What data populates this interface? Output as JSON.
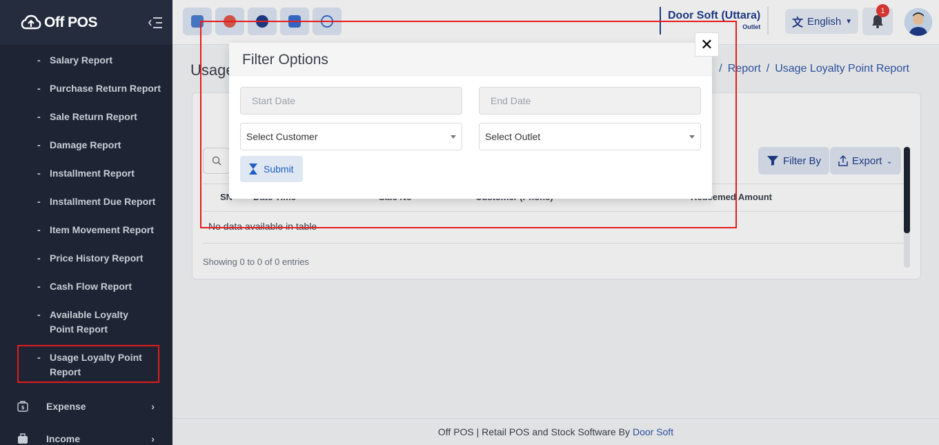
{
  "app": {
    "logo_text": "Off POS"
  },
  "sidebar": {
    "sub_items": [
      {
        "label": "Salary Report"
      },
      {
        "label": "Purchase Return Report"
      },
      {
        "label": "Sale Return Report"
      },
      {
        "label": "Damage Report"
      },
      {
        "label": "Installment Report"
      },
      {
        "label": "Installment Due Report"
      },
      {
        "label": "Item Movement Report"
      },
      {
        "label": "Price History Report"
      },
      {
        "label": "Cash Flow Report"
      },
      {
        "label": "Available Loyalty Point Report"
      },
      {
        "label": "Usage Loyalty Point Report"
      }
    ],
    "dash": "-",
    "main_items": [
      {
        "label": "Expense",
        "icon": "expense-icon"
      },
      {
        "label": "Income",
        "icon": "income-icon"
      }
    ]
  },
  "header": {
    "store_name": "Door Soft (Uttara)",
    "store_sub": "Outlet",
    "language": "English",
    "notification_count": "1"
  },
  "page": {
    "title": "Usage Loyalty Point Report",
    "breadcrumb": [
      "Report",
      "Usage Loyalty Point Report"
    ],
    "breadcrumb_sep": "/",
    "filter_label": "Filter By",
    "export_label": "Export",
    "table": {
      "columns": [
        "SN",
        "Date Time",
        "Sale No",
        "Customer (Phone)",
        "Redeemed Amount"
      ],
      "empty_text": "No data available in table",
      "info": "Showing 0 to 0 of 0 entries"
    }
  },
  "modal": {
    "title": "Filter Options",
    "start_date_placeholder": "Start Date",
    "end_date_placeholder": "End Date",
    "customer_select": "Select Customer",
    "outlet_select": "Select Outlet",
    "submit_label": "Submit",
    "close_glyph": "✕"
  },
  "footer": {
    "text": "Off POS | Retail POS and Stock Software By",
    "link": "Door Soft"
  },
  "colors": {
    "sidebar_bg": "#1e2434",
    "accent": "#1f3c8a",
    "highlight": "#e51b1b"
  }
}
